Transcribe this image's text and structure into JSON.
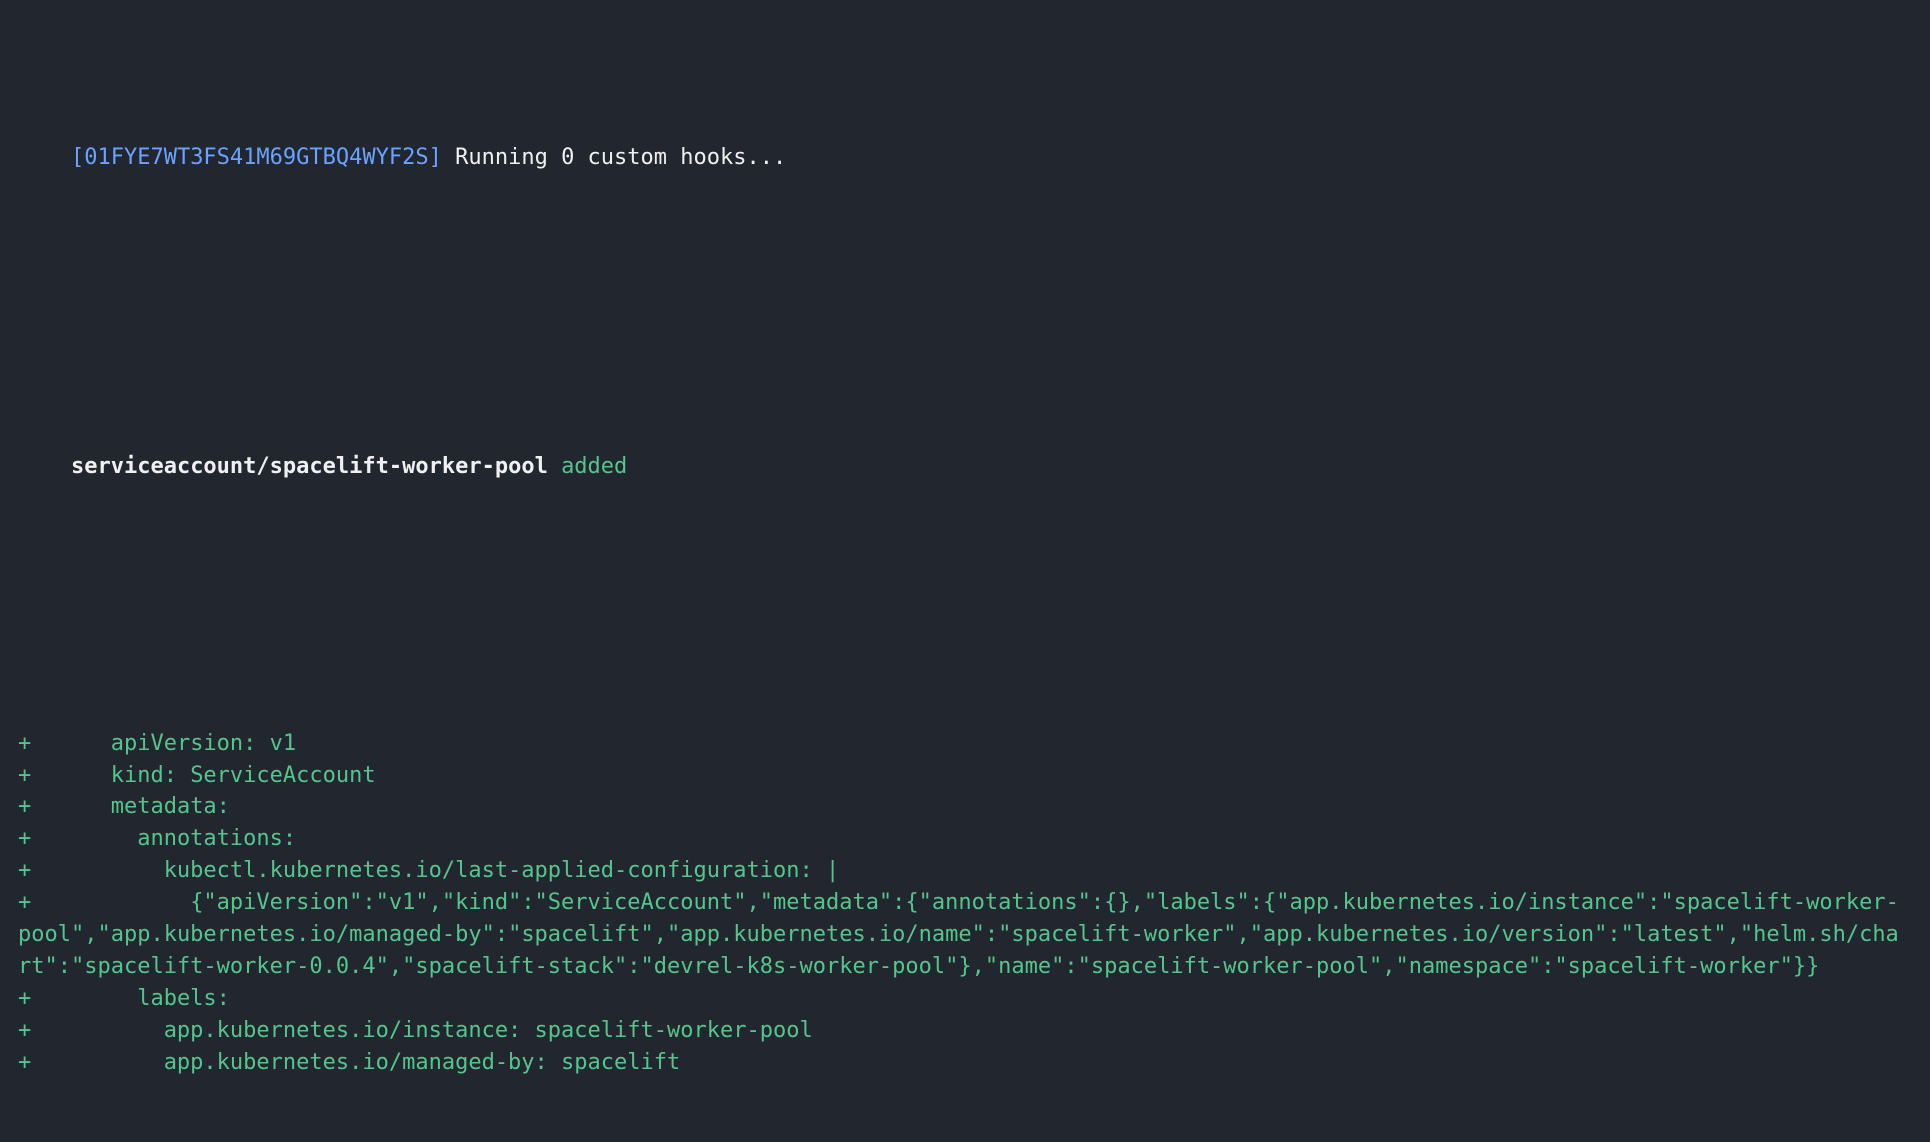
{
  "header": {
    "run_id_bracketed": "[01FYE7WT3FS41M69GTBQ4WYF2S]",
    "message": "Running 0 custom hooks..."
  },
  "resource": {
    "path": "serviceaccount/spacelift-worker-pool",
    "status": "added"
  },
  "diff": {
    "lines": [
      {
        "plus": "+",
        "indent": "      ",
        "text": "apiVersion: v1"
      },
      {
        "plus": "+",
        "indent": "      ",
        "text": "kind: ServiceAccount"
      },
      {
        "plus": "+",
        "indent": "      ",
        "text": "metadata:"
      },
      {
        "plus": "+",
        "indent": "        ",
        "text": "annotations:"
      },
      {
        "plus": "+",
        "indent": "          ",
        "text": "kubectl.kubernetes.io/last-applied-configuration: |"
      },
      {
        "plus": "+",
        "indent": "            ",
        "text": "{\"apiVersion\":\"v1\",\"kind\":\"ServiceAccount\",\"metadata\":{\"annotations\":{},\"labels\":{\"app.kubernetes.io/instance\":\"spacelift-worker-pool\",\"app.kubernetes.io/managed-by\":\"spacelift\",\"app.kubernetes.io/name\":\"spacelift-worker\",\"app.kubernetes.io/version\":\"latest\",\"helm.sh/chart\":\"spacelift-worker-0.0.4\",\"spacelift-stack\":\"devrel-k8s-worker-pool\"},\"name\":\"spacelift-worker-pool\",\"namespace\":\"spacelift-worker\"}}"
      },
      {
        "plus": "+",
        "indent": "        ",
        "text": "labels:"
      },
      {
        "plus": "+",
        "indent": "          ",
        "text": "app.kubernetes.io/instance: spacelift-worker-pool"
      },
      {
        "plus": "+",
        "indent": "          ",
        "text": "app.kubernetes.io/managed-by: spacelift"
      }
    ]
  }
}
